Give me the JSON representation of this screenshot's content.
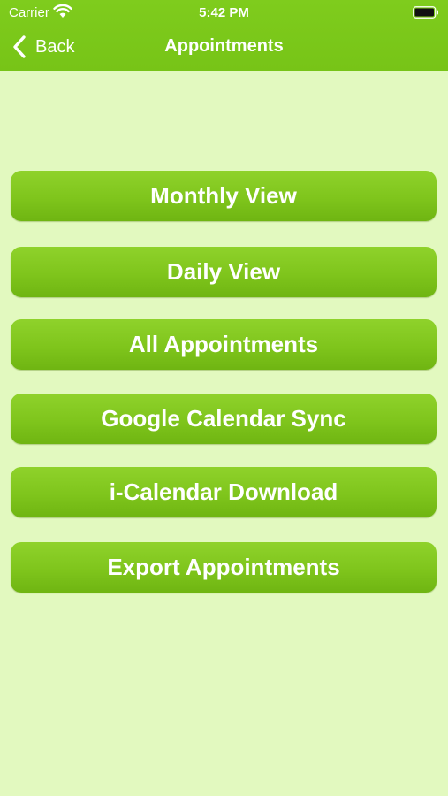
{
  "status_bar": {
    "carrier": "Carrier",
    "time": "5:42 PM",
    "wifi_icon": "wifi-icon",
    "battery_icon": "battery-icon"
  },
  "nav": {
    "back_label": "Back",
    "back_icon": "chevron-left-icon",
    "title": "Appointments"
  },
  "menu": {
    "monthly": "Monthly View",
    "daily": "Daily View",
    "all": "All Appointments",
    "google": "Google Calendar Sync",
    "icalendar": "i-Calendar Download",
    "export": "Export Appointments"
  },
  "colors": {
    "background": "#e2f9bf",
    "bar": "#7cc81b",
    "button": "#7fc51c",
    "text": "#ffffff"
  }
}
